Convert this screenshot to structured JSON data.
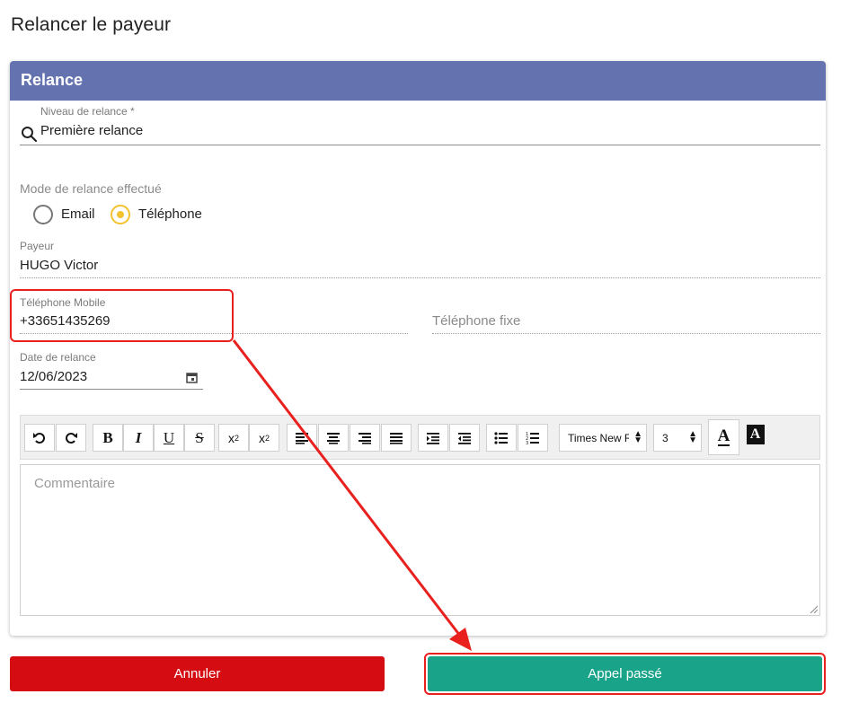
{
  "page": {
    "title": "Relancer le payeur"
  },
  "card": {
    "title": "Relance"
  },
  "niveau": {
    "label": "Niveau de relance *",
    "value": "Première relance",
    "icon": "search-icon"
  },
  "mode": {
    "label": "Mode de relance effectué",
    "options": [
      {
        "label": "Email",
        "checked": false
      },
      {
        "label": "Téléphone",
        "checked": true
      }
    ]
  },
  "payeur": {
    "label": "Payeur",
    "value": "HUGO Victor"
  },
  "mobile": {
    "label": "Téléphone Mobile",
    "value": "+33651435269"
  },
  "fixe": {
    "placeholder": "Téléphone fixe"
  },
  "date": {
    "label": "Date de relance",
    "value": "12/06/2023",
    "icon": "calendar-icon"
  },
  "toolbar": {
    "font": "Times New Roman",
    "size": "3"
  },
  "editor": {
    "placeholder": "Commentaire"
  },
  "buttons": {
    "cancel": "Annuler",
    "submit": "Appel passé"
  },
  "colors": {
    "header": "#6473b0",
    "accent": "#f2c230",
    "cancel": "#d50d13",
    "submit": "#19a48a",
    "annotation": "#e8211f"
  }
}
